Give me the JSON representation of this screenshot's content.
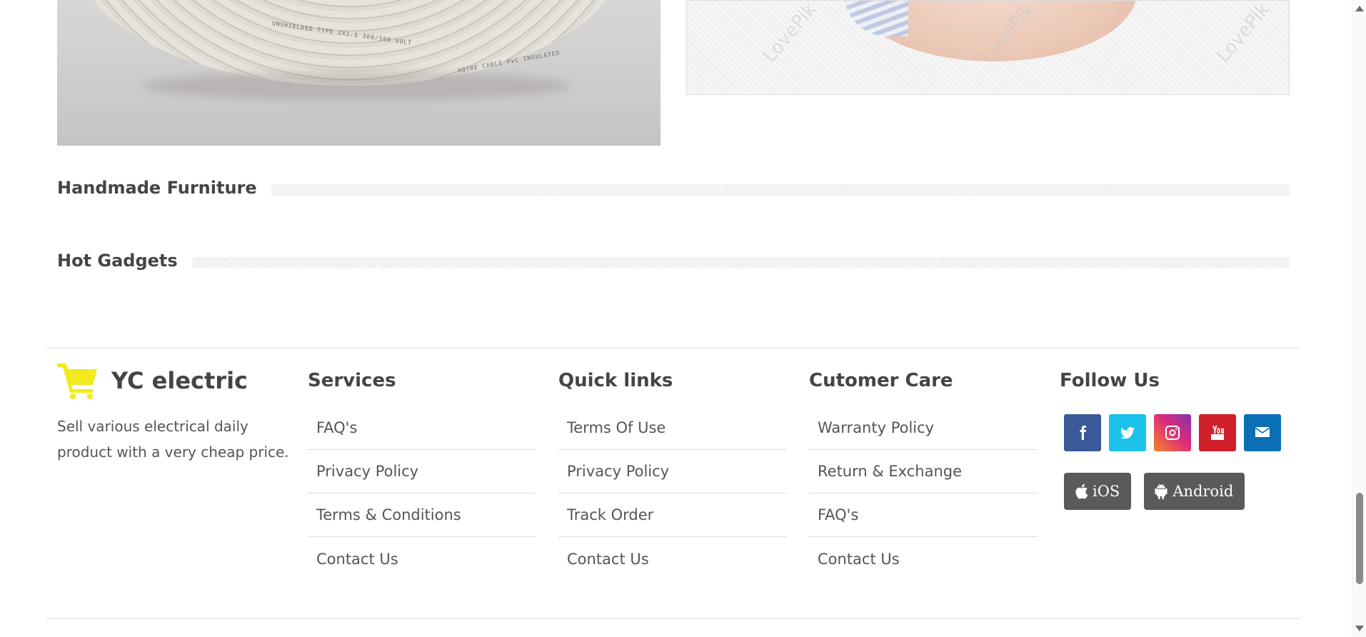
{
  "product_images": [
    {
      "name": "cable-coil",
      "cable_text": "UNSHIELDED TYPE 2X1.5   300/500 VOLT",
      "cable_text_2": "VOTRE CABLE PVC INSULATED"
    },
    {
      "name": "tape-roll",
      "watermark": "LovePik"
    }
  ],
  "sections": [
    {
      "title": "Handmade Furniture"
    },
    {
      "title": "Hot Gadgets"
    }
  ],
  "footer": {
    "brand": {
      "name": "YC electric",
      "description": "Sell various electrical daily product with a very cheap price.",
      "icon": "cart-icon",
      "icon_color": "#f2ea1e"
    },
    "services": {
      "title": "Services",
      "links": [
        "FAQ's",
        "Privacy Policy",
        "Terms & Conditions",
        "Contact Us"
      ]
    },
    "quick_links": {
      "title": "Quick links",
      "links": [
        "Terms Of Use",
        "Privacy Policy",
        "Track Order",
        "Contact Us"
      ]
    },
    "customer_care": {
      "title": "Cutomer Care",
      "links": [
        "Warranty Policy",
        "Return & Exchange",
        "FAQ's",
        "Contact Us"
      ]
    },
    "follow": {
      "title": "Follow Us",
      "socials": [
        {
          "icon": "facebook-icon",
          "color": "#3b5998"
        },
        {
          "icon": "twitter-icon",
          "color": "#1dc2ea"
        },
        {
          "icon": "instagram-icon",
          "color": "#dd2a7b"
        },
        {
          "icon": "youtube-icon",
          "color": "#d11f2b"
        },
        {
          "icon": "mail-icon",
          "color": "#0a6fb5"
        }
      ],
      "apps": [
        {
          "label": "iOS",
          "icon": "apple-icon"
        },
        {
          "label": "Android",
          "icon": "android-icon"
        }
      ]
    }
  }
}
